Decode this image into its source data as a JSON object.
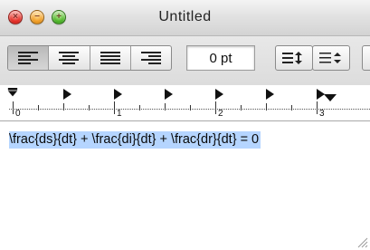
{
  "window": {
    "title": "Untitled",
    "traffic_lights": {
      "close_glyph": "×",
      "min_glyph": "−",
      "zoom_glyph": "+"
    }
  },
  "toolbar": {
    "alignment_buttons": [
      {
        "name": "align-left",
        "icon": "align-left-icon",
        "active": true
      },
      {
        "name": "align-center",
        "icon": "align-center-icon",
        "active": false
      },
      {
        "name": "align-justify",
        "icon": "align-justify-icon",
        "active": false
      },
      {
        "name": "align-right",
        "icon": "align-right-icon",
        "active": false
      }
    ],
    "spacing_value": "0 pt",
    "line_spacing_icon": "line-spacing-icon",
    "list_bullets_icon": "list-icon"
  },
  "ruler": {
    "numbers": [
      "0",
      "1",
      "2",
      "3"
    ]
  },
  "document": {
    "text": "\\frac{ds}{dt} + \\frac{di}{dt} + \\frac{dr}{dt} = 0",
    "selection_color": "#b5d5ff"
  }
}
